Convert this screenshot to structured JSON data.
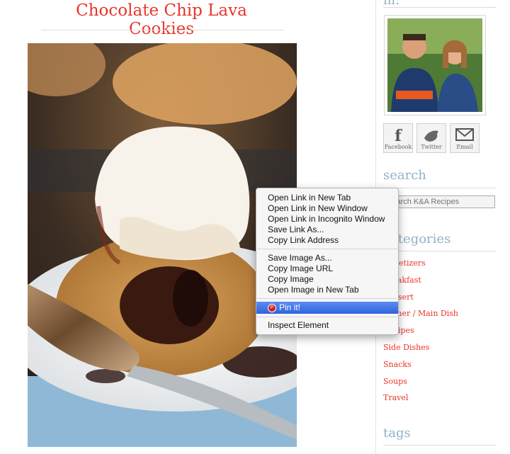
{
  "post": {
    "title": "Chocolate Chip Lava Cookies"
  },
  "sidebar": {
    "top_heading": "m:",
    "social": [
      {
        "label": "Facebook",
        "icon": "facebook-icon"
      },
      {
        "label": "Twitter",
        "icon": "twitter-icon"
      },
      {
        "label": "Email",
        "icon": "email-icon"
      }
    ],
    "search_heading": "search",
    "search_placeholder": "Search K&A Recipes",
    "categories_heading": "categories",
    "categories": [
      "Appetizers",
      "Breakfast",
      "Dessert",
      "Dinner / Main Dish",
      "Recipes",
      "Side Dishes",
      "Snacks",
      "Soups",
      "Travel"
    ],
    "tags_heading": "tags"
  },
  "context_menu": {
    "group1": [
      "Open Link in New Tab",
      "Open Link in New Window",
      "Open Link in Incognito Window",
      "Save Link As...",
      "Copy Link Address"
    ],
    "group2": [
      "Save Image As...",
      "Copy Image URL",
      "Copy Image",
      "Open Image in New Tab"
    ],
    "pin": "Pin it!",
    "inspect": "Inspect Element"
  },
  "colors": {
    "title_red": "#e8342a",
    "heading_blue": "#8fb2c7",
    "highlight": "#3b6fe3"
  }
}
